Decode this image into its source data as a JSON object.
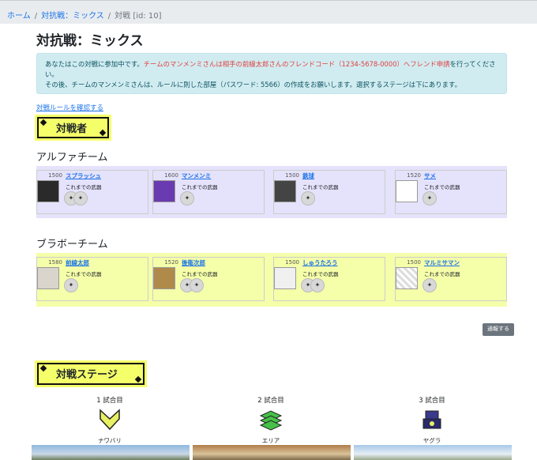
{
  "breadcrumb": {
    "home": "ホーム",
    "battle": "対抗戦：ミックス",
    "current": "対戦 [id: 10]"
  },
  "page_title": "対抗戦：ミックス",
  "alert": {
    "line1_pre": "あなたはこの対戦に参加中です。",
    "line1_red": "チームのマンメンミさんは相手の前線太郎さんのフレンドコード（1234-5678-0000）へフレンド申請",
    "line1_post": "を行ってください。",
    "line2": "その後、チームのマンメンミさんは、ルールに則した部屋（パスワード: 5566）の作成をお願いします。選択するステージは下にあります。"
  },
  "rules_link": "対戦ルールを確認する",
  "players_heading": "対戦者",
  "teams": [
    {
      "name": "アルファチーム",
      "color": "#e5e2fb",
      "members": [
        {
          "rate": "1500",
          "name": "スプラッシュ",
          "weapons_label": "これまでの武器",
          "avatar_color": "#2a2a2a"
        },
        {
          "rate": "1600",
          "name": "マンメンミ",
          "weapons_label": "これまでの武器",
          "avatar_color": "#6a3ab0"
        },
        {
          "rate": "1500",
          "name": "鉄球",
          "weapons_label": "これまでの武器",
          "avatar_color": "#444444"
        },
        {
          "rate": "1520",
          "name": "サメ",
          "weapons_label": "これまでの武器",
          "avatar_color": "#ffffff"
        }
      ]
    },
    {
      "name": "ブラボーチーム",
      "color": "#f5ffa9",
      "members": [
        {
          "rate": "1580",
          "name": "前線太郎",
          "weapons_label": "これまでの武器",
          "avatar_color": "#d9d5cc"
        },
        {
          "rate": "1520",
          "name": "後衛次郎",
          "weapons_label": "これまでの武器",
          "avatar_color": "#b08a4a"
        },
        {
          "rate": "1500",
          "name": "しゅうたろう",
          "weapons_label": "これまでの武器",
          "avatar_color": "#f0f0f0"
        },
        {
          "rate": "1500",
          "name": "マルミサマン",
          "weapons_label": "これまでの武器",
          "avatar_color": "#e8e8e8"
        }
      ]
    }
  ],
  "report_button": "通報する",
  "stage_heading": "対戦ステージ",
  "stages": [
    {
      "number": "1 試合目",
      "mode": "ナワバリ",
      "icon": "nawabari-icon"
    },
    {
      "number": "2 試合目",
      "mode": "エリア",
      "icon": "area-icon"
    },
    {
      "number": "3 試合目",
      "mode": "ヤグラ",
      "icon": "yagura-icon"
    }
  ]
}
